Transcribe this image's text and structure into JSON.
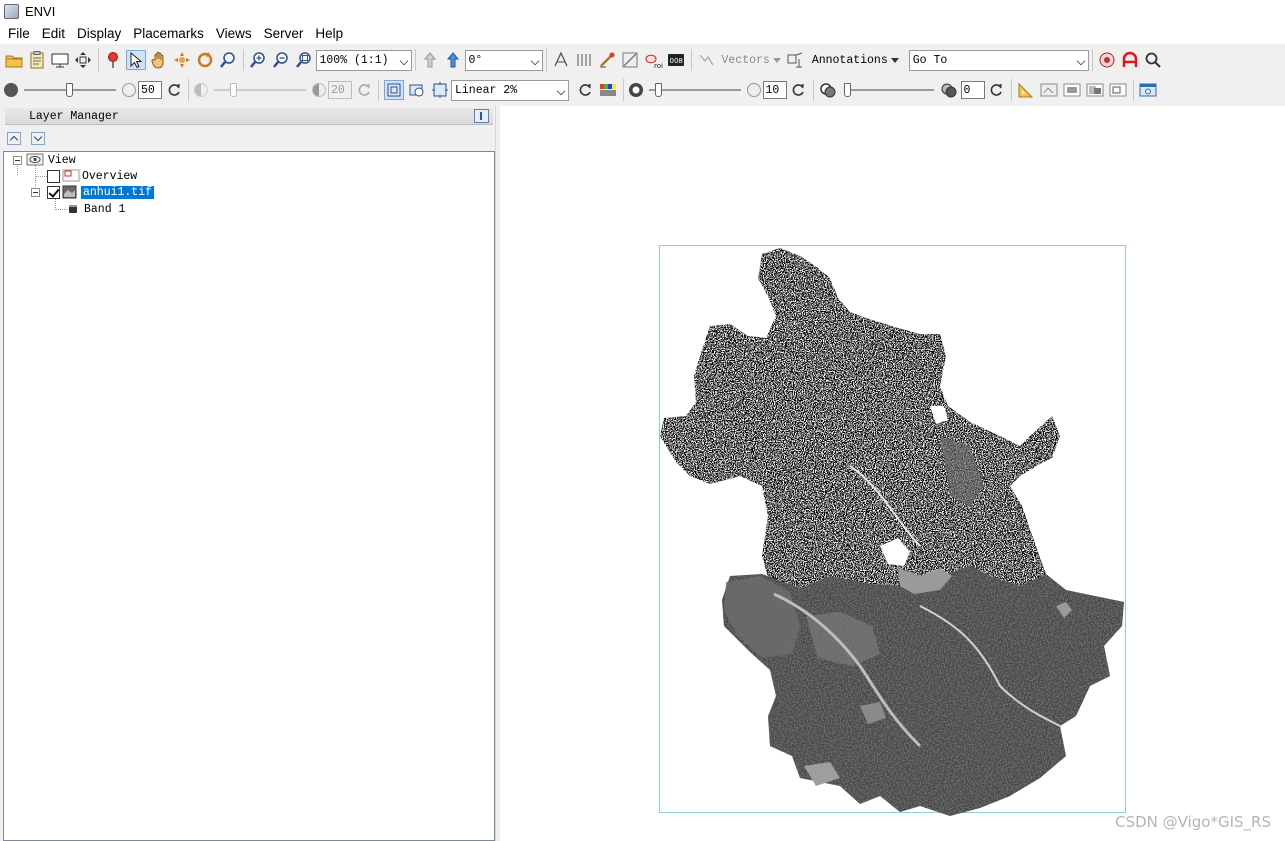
{
  "app": {
    "title": "ENVI"
  },
  "menu": [
    "File",
    "Edit",
    "Display",
    "Placemarks",
    "Views",
    "Server",
    "Help"
  ],
  "toolbar1": {
    "zoom_value": "100% (1:1)",
    "rotation_value": "0°",
    "vectors_label": "Vectors",
    "annotations_label": "Annotations",
    "goto_value": "Go To"
  },
  "toolbar2": {
    "brightness_value": "50",
    "contrast_value": "20",
    "stretch_value": "Linear 2%",
    "sharpen_value": "10",
    "transparency_value": "0"
  },
  "layer_manager": {
    "title": "Layer Manager",
    "tree": {
      "view_label": "View",
      "overview_label": "Overview",
      "overview_checked": false,
      "layer_label": "anhui1.tif",
      "layer_checked": true,
      "band_label": "Band 1"
    }
  },
  "watermark": "CSDN @Vigo*GIS_RS",
  "colors": {
    "selection": "#0078d7",
    "frame": "#8fd0cf",
    "map_dark": "#000000",
    "map_grey": "#444444"
  }
}
